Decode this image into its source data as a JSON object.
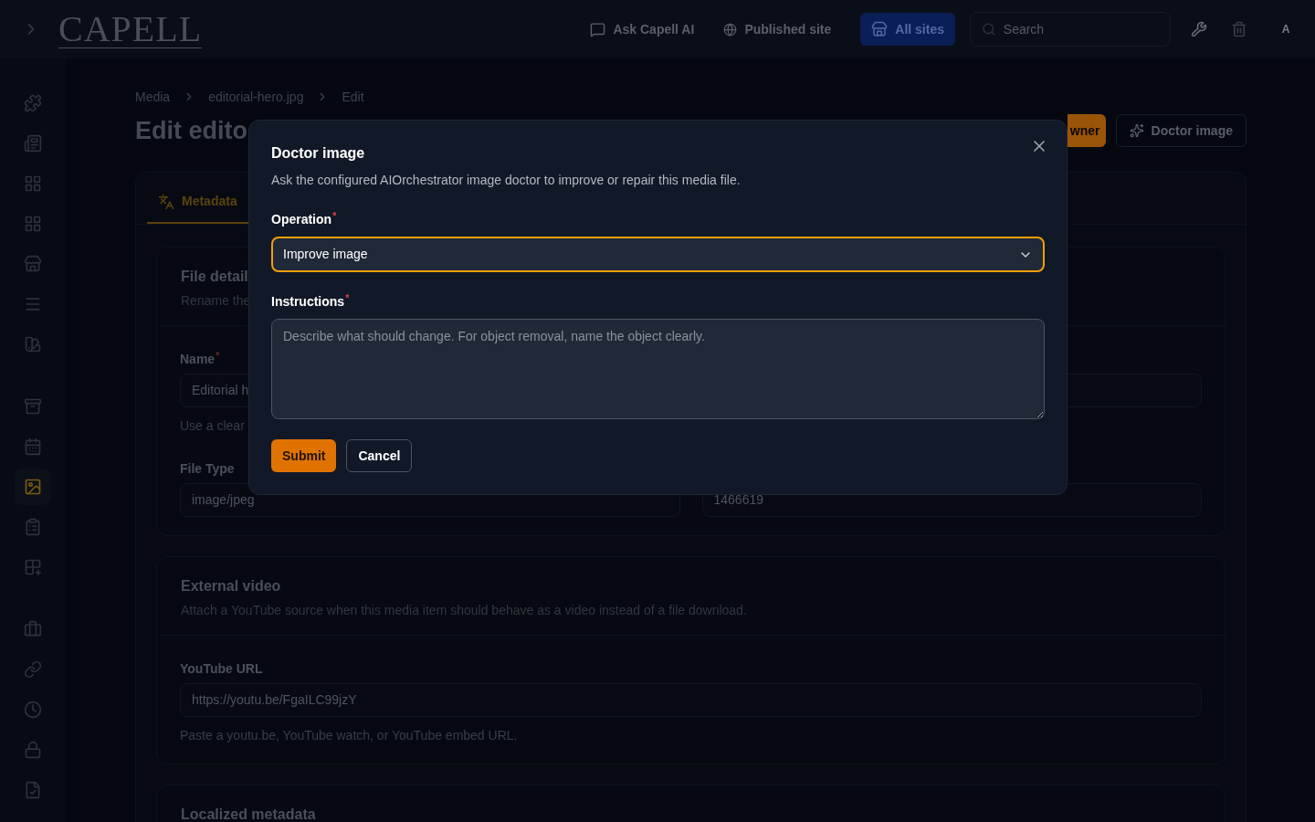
{
  "header": {
    "logo": "CAPELL",
    "links": [
      {
        "label": "Ask Capell AI"
      },
      {
        "label": "Published site"
      }
    ],
    "site_button": "All sites",
    "search": {
      "placeholder": "Search"
    },
    "avatar": "A"
  },
  "sidebar": {
    "items": [
      {
        "selected": false
      },
      {
        "selected": false
      },
      {
        "selected": false
      },
      {
        "selected": false
      },
      {
        "selected": false
      },
      {
        "selected": false
      },
      {
        "selected": false
      },
      {
        "selected": false
      },
      {
        "selected": false
      },
      {
        "selected": true
      },
      {
        "selected": false
      },
      {
        "selected": false
      },
      {
        "selected": false
      },
      {
        "selected": false
      },
      {
        "selected": false
      },
      {
        "selected": false
      },
      {
        "selected": false
      }
    ]
  },
  "breadcrumbs": [
    "Media",
    "editorial-hero.jpg",
    "Edit"
  ],
  "page_title": "Edit edito",
  "actions": [
    {
      "label": "wner",
      "kind": "primary"
    },
    {
      "label": "Doctor image",
      "kind": "secondary"
    }
  ],
  "tabs": [
    {
      "label": "Metadata",
      "selected": true
    }
  ],
  "sections": [
    {
      "title": "File detail",
      "description": "Rename the",
      "rows": [
        [
          {
            "label": "Name",
            "required": "*",
            "value": "Editorial h",
            "help": "Use a clear"
          },
          {}
        ],
        [
          {
            "label": "File Type",
            "value": "image/jpeg"
          },
          {
            "value": "1466619"
          }
        ]
      ]
    },
    {
      "title": "External video",
      "description": "Attach a YouTube source when this media item should behave as a video instead of a file download.",
      "rows": [
        [
          {
            "label": "YouTube URL",
            "value": "https://youtu.be/FgaILC99jzY",
            "help": "Paste a youtu.be, YouTube watch, or YouTube embed URL."
          }
        ]
      ]
    },
    {
      "title": "Localized metadata"
    }
  ],
  "dialog": {
    "title": "Doctor image",
    "description": "Ask the configured AIOrchestrator image doctor to improve or repair this media file.",
    "fields": [
      {
        "kind": "select",
        "label": "Operation",
        "required": "*",
        "value": "Improve image",
        "focused": true
      },
      {
        "kind": "textarea",
        "label": "Instructions",
        "required": "*",
        "placeholder": "Describe what should change. For object removal, name the object clearly.",
        "focused": false
      }
    ],
    "buttons": [
      {
        "label": "Submit",
        "kind": "primary"
      },
      {
        "label": "Cancel",
        "kind": "secondary"
      }
    ]
  }
}
